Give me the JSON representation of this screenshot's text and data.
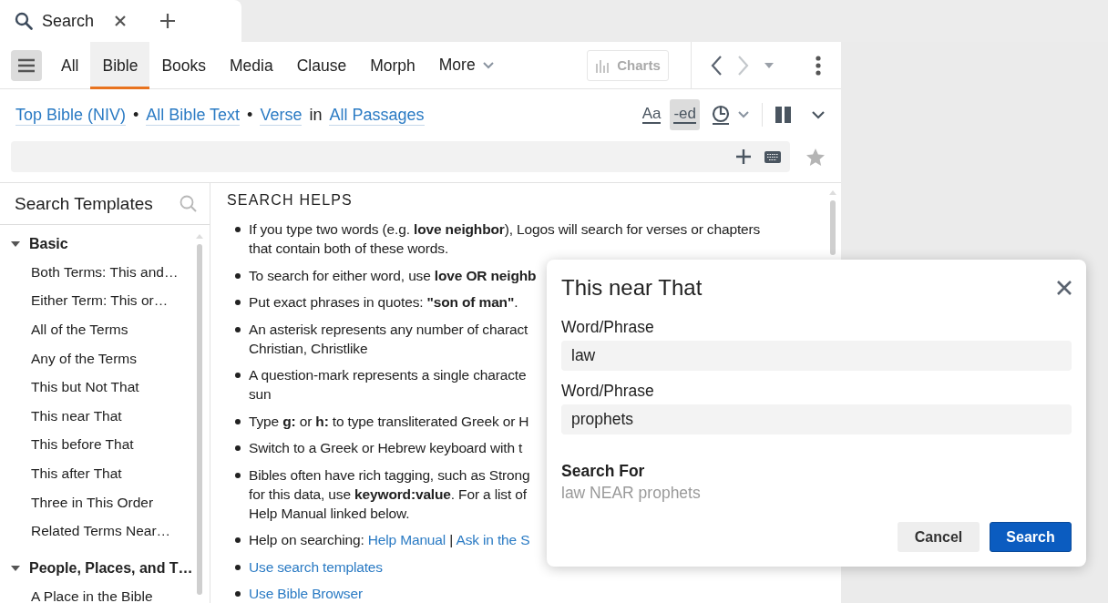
{
  "tab_bar": {
    "tabs": [
      {
        "label": "Search",
        "selected": true
      }
    ]
  },
  "toolbar": {
    "tabs": [
      {
        "label": "All",
        "selected": false
      },
      {
        "label": "Bible",
        "selected": true
      },
      {
        "label": "Books",
        "selected": false
      },
      {
        "label": "Media",
        "selected": false
      },
      {
        "label": "Clause",
        "selected": false
      },
      {
        "label": "Morph",
        "selected": false
      }
    ],
    "more": "More",
    "charts": {
      "label": "Charts",
      "disabled": true
    },
    "back": {
      "disabled": false
    },
    "forward": {
      "disabled": true
    }
  },
  "scope": {
    "parts": [
      {
        "kind": "link",
        "text": "Top Bible (NIV)"
      },
      {
        "kind": "text",
        "text": "•"
      },
      {
        "kind": "link",
        "text": "All Bible Text"
      },
      {
        "kind": "text",
        "text": "•"
      },
      {
        "kind": "link",
        "text": "Verse"
      },
      {
        "kind": "text",
        "text": "in"
      },
      {
        "kind": "link",
        "text": "All Passages"
      }
    ],
    "toggles": [
      {
        "kind": "text",
        "label": "Aa",
        "on": false
      },
      {
        "kind": "text",
        "label": "-ed",
        "on": true
      }
    ]
  },
  "templates": {
    "title": "Search Templates",
    "groups": [
      {
        "label": "Basic",
        "expanded": true,
        "children": [
          {
            "label": "Both Terms: This and…"
          },
          {
            "label": "Either Term: This or…"
          },
          {
            "label": "All of the Terms"
          },
          {
            "label": "Any of the Terms"
          },
          {
            "label": "This but Not That"
          },
          {
            "label": "This near That"
          },
          {
            "label": "This before That"
          },
          {
            "label": "This after That"
          },
          {
            "label": "Three in This Order"
          },
          {
            "label": "Related Terms Near…"
          }
        ]
      },
      {
        "label": "People, Places, and T…",
        "expanded": true,
        "children": [
          {
            "label": "A Place in the Bible"
          }
        ]
      }
    ]
  },
  "help": {
    "title": "SEARCH HELPS",
    "items": [
      {
        "kind": "text",
        "lines": [
          "If you type two words (e.g. **love neighbor**), Logos will search for verses or chapters",
          "that contain both of these words."
        ]
      },
      {
        "kind": "text",
        "lines": [
          "To search for either word, use **love OR neighb**"
        ]
      },
      {
        "kind": "text",
        "lines": [
          "Put exact phrases in quotes: **\"son of man\"**."
        ]
      },
      {
        "kind": "text",
        "lines": [
          "An asterisk represents any number of charact",
          "Christian, Christlike"
        ]
      },
      {
        "kind": "text",
        "lines": [
          "A question-mark represents a single characte",
          "sun"
        ]
      },
      {
        "kind": "text",
        "lines": [
          "Type **g:** or **h:** to type transliterated Greek or H"
        ]
      },
      {
        "kind": "text",
        "lines": [
          "Switch to a Greek or Hebrew keyboard with t"
        ]
      },
      {
        "kind": "text",
        "lines": [
          "Bibles often have rich tagging, such as Strong",
          "for this data, use **keyword:value**. For a list of",
          "Help Manual linked below."
        ]
      },
      {
        "kind": "links",
        "parts": [
          {
            "kind": "text",
            "text": "Help on searching:"
          },
          {
            "kind": "link",
            "text": "Help Manual"
          },
          {
            "kind": "text",
            "text": "|"
          },
          {
            "kind": "link",
            "text": "Ask in the S"
          }
        ]
      },
      {
        "kind": "link",
        "text": "Use search templates"
      },
      {
        "kind": "link",
        "text": "Use Bible Browser"
      }
    ]
  },
  "dialog": {
    "title": "This near That",
    "fields": [
      {
        "label": "Word/Phrase",
        "value": "law"
      },
      {
        "label": "Word/Phrase",
        "value": "prophets"
      }
    ],
    "search_for": {
      "label": "Search For",
      "value": "law NEAR prophets"
    },
    "buttons": [
      {
        "label": "Cancel",
        "kind": "secondary"
      },
      {
        "label": "Search",
        "kind": "primary"
      }
    ]
  }
}
